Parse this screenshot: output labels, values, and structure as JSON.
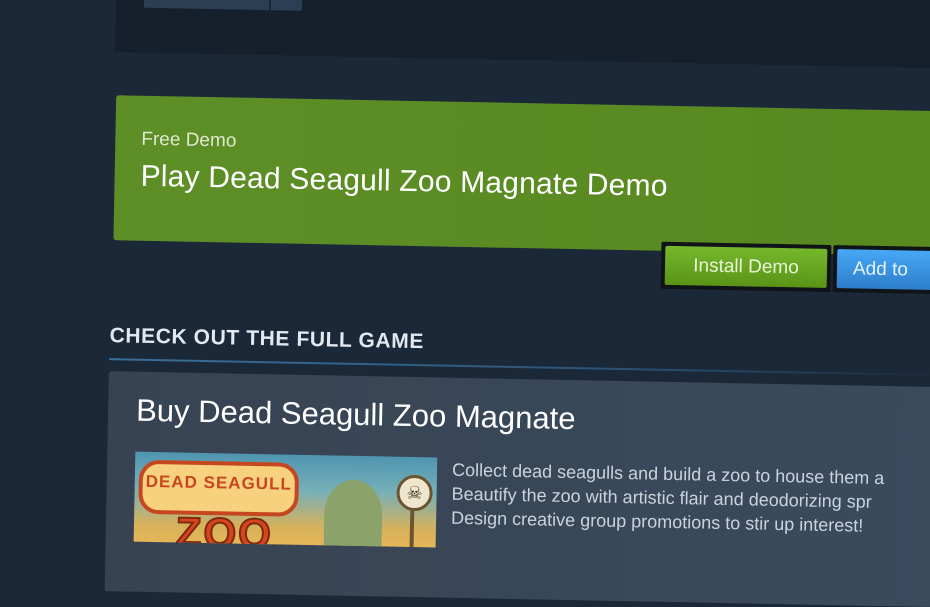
{
  "demo": {
    "eyebrow": "Free Demo",
    "title": "Play Dead Seagull Zoo Magnate Demo",
    "install_label": "Install Demo",
    "wishlist_label": "Add to"
  },
  "full_game": {
    "section_header": "CHECK OUT THE FULL GAME",
    "buy_title": "Buy Dead Seagull Zoo Magnate",
    "capsule_logo_top": "DEAD SEAGULL",
    "capsule_logo_big": "ZOO",
    "description_lines": [
      "Collect dead seagulls and build a zoo to house them a",
      "Beautify the zoo with artistic flair and deodorizing spr",
      "Design creative group promotions to stir up interest!"
    ]
  },
  "colors": {
    "page_bg": "#1b2838",
    "demo_banner": "#5e8f27",
    "install_button": "#6aa824",
    "wishlist_button": "#3a94e6"
  }
}
